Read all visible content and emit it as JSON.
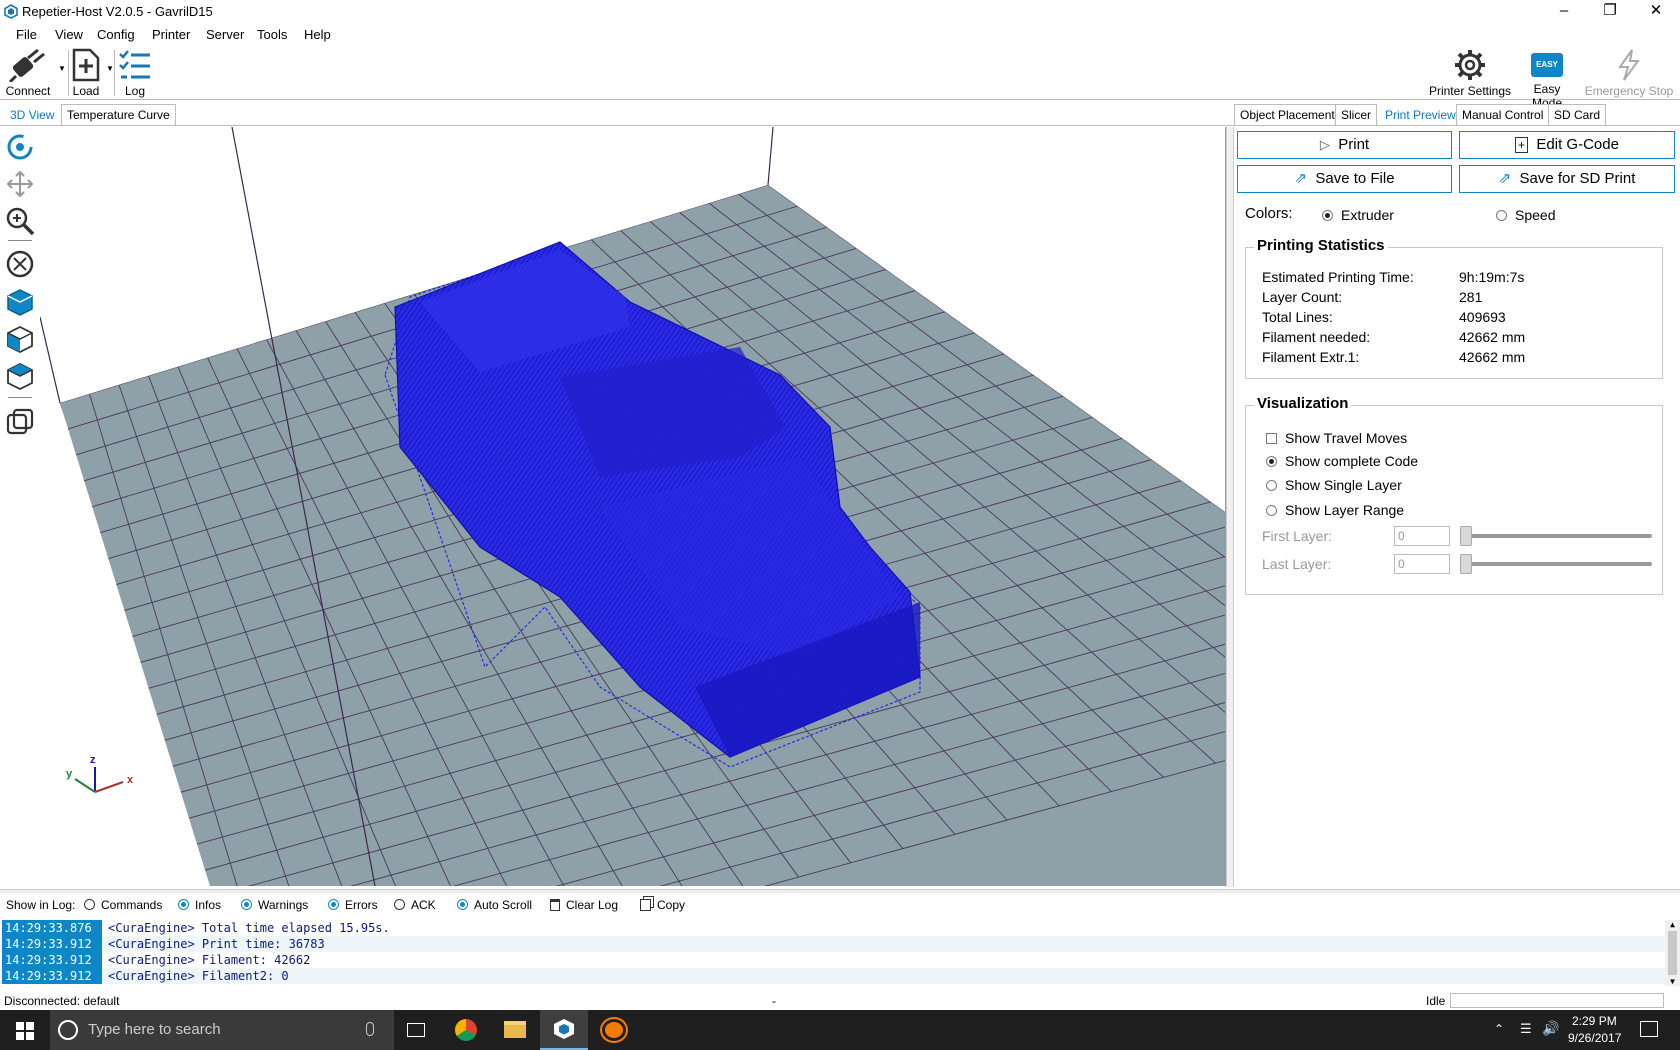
{
  "window": {
    "title": "Repetier-Host V2.0.5 - GavrilD15"
  },
  "menu": [
    "File",
    "View",
    "Config",
    "Printer",
    "Server",
    "Tools",
    "Help"
  ],
  "toolbar": {
    "connect": "Connect",
    "load": "Load",
    "log": "Log",
    "printer_settings": "Printer Settings",
    "easy_mode": "Easy Mode",
    "easy_badge": "EASY",
    "emergency_stop": "Emergency Stop"
  },
  "left_tabs": [
    "3D View",
    "Temperature Curve"
  ],
  "right_tabs": [
    "Object Placement",
    "Slicer",
    "Print Preview",
    "Manual Control",
    "SD Card"
  ],
  "actions": {
    "print": "Print",
    "edit_gcode": "Edit G-Code",
    "save_file": "Save to File",
    "save_sd": "Save for SD Print"
  },
  "colors": {
    "label": "Colors:",
    "extruder": "Extruder",
    "speed": "Speed"
  },
  "stats": {
    "title": "Printing Statistics",
    "rows": [
      {
        "label": "Estimated Printing Time:",
        "value": "9h:19m:7s"
      },
      {
        "label": "Layer Count:",
        "value": "281"
      },
      {
        "label": "Total Lines:",
        "value": "409693"
      },
      {
        "label": "Filament needed:",
        "value": "42662 mm"
      },
      {
        "label": "Filament Extr.1:",
        "value": "42662 mm"
      }
    ]
  },
  "visualization": {
    "title": "Visualization",
    "travel": "Show Travel Moves",
    "complete": "Show complete Code",
    "single": "Show Single Layer",
    "range": "Show Layer Range",
    "first_layer": "First Layer:",
    "last_layer": "Last Layer:",
    "first_value": "0",
    "last_value": "0"
  },
  "log_options": {
    "label": "Show in Log:",
    "commands": "Commands",
    "infos": "Infos",
    "warnings": "Warnings",
    "errors": "Errors",
    "ack": "ACK",
    "auto_scroll": "Auto Scroll",
    "clear": "Clear Log",
    "copy": "Copy"
  },
  "log": [
    {
      "time": "14:29:33.876",
      "msg": "<CuraEngine> Total time elapsed 15.95s."
    },
    {
      "time": "14:29:33.912",
      "msg": "<CuraEngine> Print time: 36783"
    },
    {
      "time": "14:29:33.912",
      "msg": "<CuraEngine> Filament: 42662"
    },
    {
      "time": "14:29:33.912",
      "msg": "<CuraEngine> Filament2: 0"
    }
  ],
  "status": {
    "left": "Disconnected: default",
    "center": "-",
    "right": "Idle"
  },
  "taskbar": {
    "search": "Type here to search",
    "time": "2:29 PM",
    "date": "9/26/2017"
  },
  "axes": {
    "x": "x",
    "y": "y",
    "z": "z"
  },
  "accent": "#0f86c5",
  "model_color": "#2020e0",
  "bed_color": "#8ea0a8"
}
